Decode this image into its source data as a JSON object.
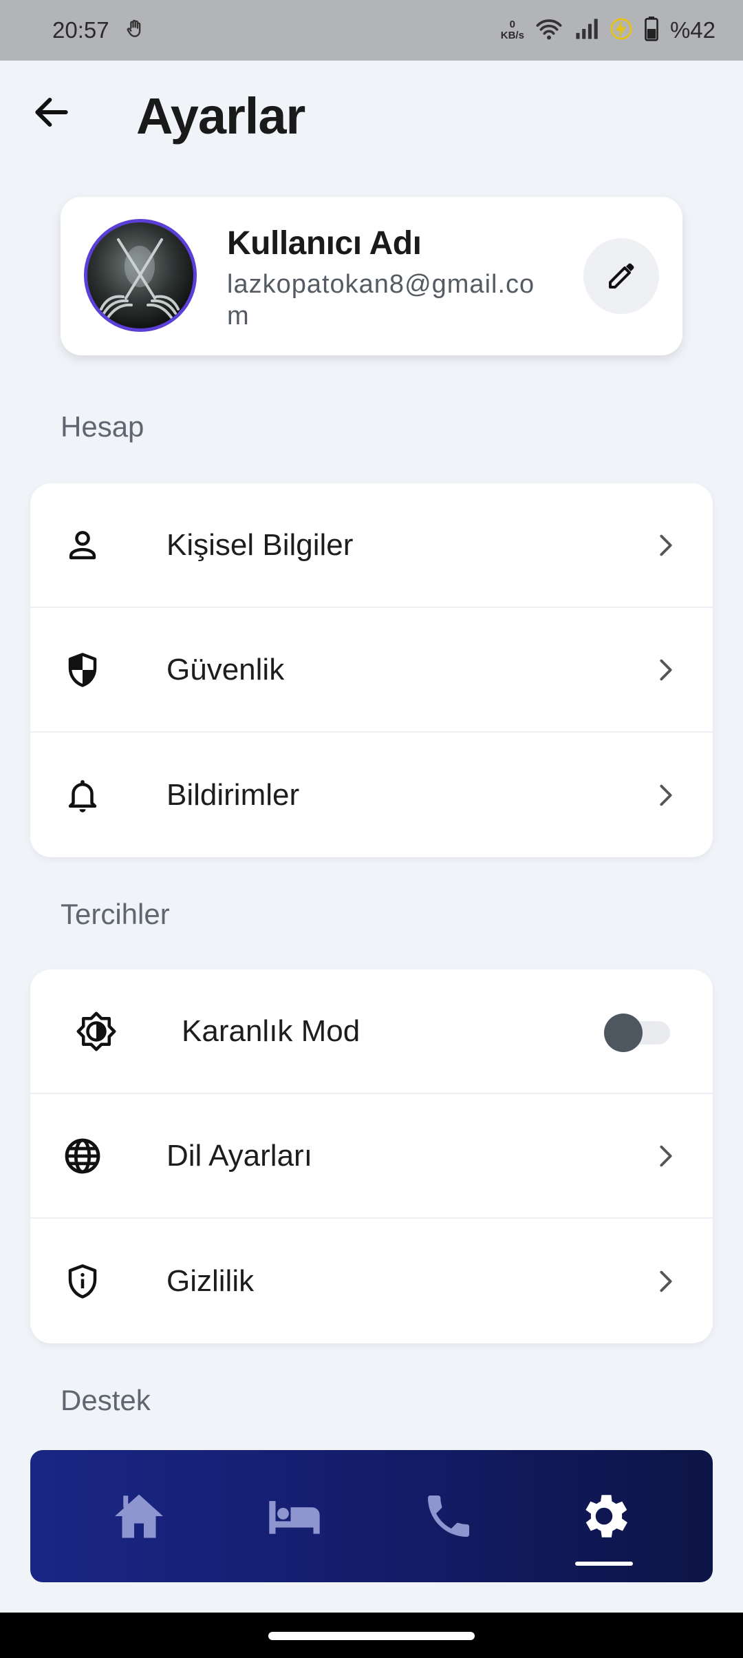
{
  "status_bar": {
    "time": "20:57",
    "speed_value": "0",
    "speed_unit": "KB/s",
    "battery": "%42"
  },
  "header": {
    "title": "Ayarlar"
  },
  "profile": {
    "name": "Kullanıcı Adı",
    "email": "lazkopatokan8@gmail.com"
  },
  "sections": {
    "account": {
      "label": "Hesap",
      "items": [
        {
          "label": "Kişisel Bilgiler",
          "icon": "person-icon"
        },
        {
          "label": "Güvenlik",
          "icon": "shield-icon"
        },
        {
          "label": "Bildirimler",
          "icon": "bell-icon"
        }
      ]
    },
    "preferences": {
      "label": "Tercihler",
      "items": [
        {
          "label": "Karanlık Mod",
          "icon": "brightness-icon",
          "toggle_on": false
        },
        {
          "label": "Dil Ayarları",
          "icon": "globe-icon"
        },
        {
          "label": "Gizlilik",
          "icon": "privacy-icon"
        }
      ]
    },
    "support": {
      "label": "Destek"
    }
  },
  "bottom_nav": {
    "items": [
      "home-icon",
      "bed-icon",
      "phone-icon",
      "settings-icon"
    ],
    "active_index": 3
  },
  "colors": {
    "background": "#f0f3f8",
    "avatar_ring": "#5b3fd6",
    "nav_gradient_start": "#1a2685",
    "nav_gradient_end": "#0d1446",
    "nav_inactive_icon": "#8e95cf"
  }
}
